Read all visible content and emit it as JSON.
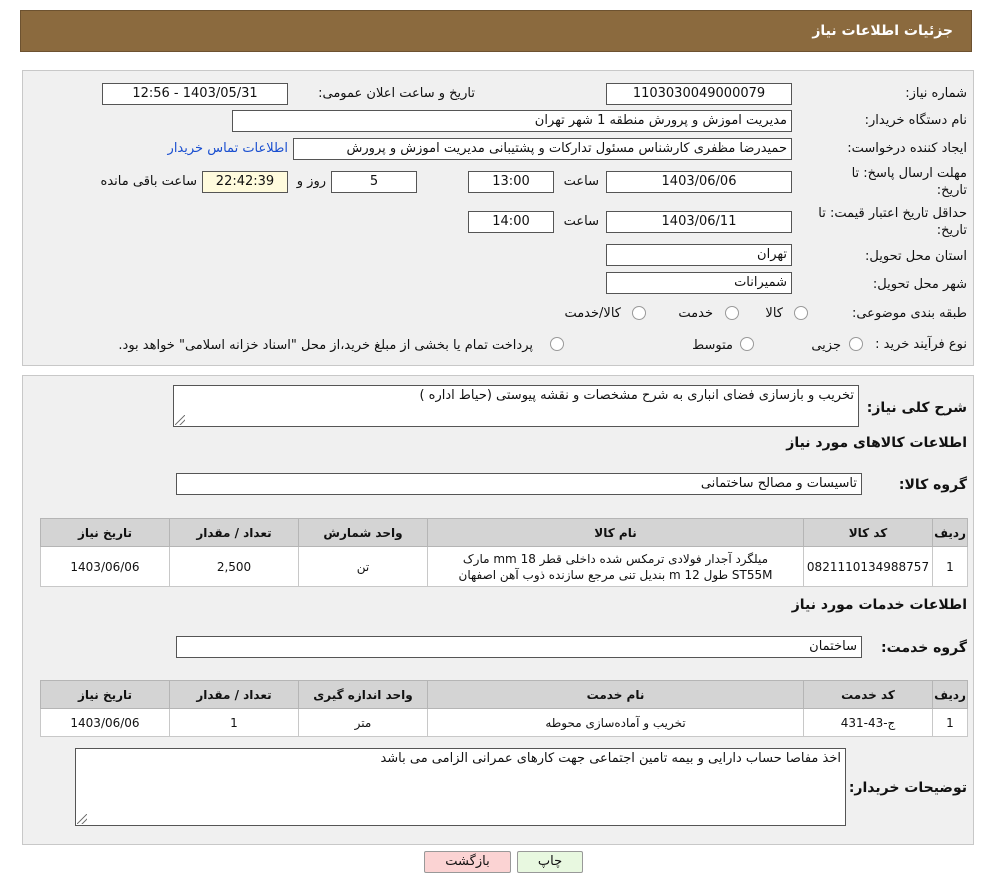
{
  "header": {
    "title": "جزئیات اطلاعات نیاز"
  },
  "top": {
    "need_number_label": "شماره نیاز:",
    "need_number": "1103030049000079",
    "announce_label": "تاریخ و ساعت اعلان عمومی:",
    "announce_value": "1403/05/31 - 12:56",
    "buyer_org_label": "نام دستگاه خریدار:",
    "buyer_org": "مدیریت اموزش و پرورش منطقه 1 شهر تهران",
    "creator_label": "ایجاد کننده درخواست:",
    "creator": "حمیدرضا مظفری کارشناس مسئول تدارکات و پشتیبانی مدیریت اموزش و پرورش",
    "contact_link": "اطلاعات تماس خریدار",
    "deadline_label_1": "مهلت ارسال پاسخ: تا",
    "deadline_label_2": "تاریخ:",
    "deadline_date": "1403/06/06",
    "time_label": "ساعت",
    "deadline_time": "13:00",
    "days_value": "5",
    "days_label": "روز و",
    "remaining_time": "22:42:39",
    "remaining_label": "ساعت باقی مانده",
    "validity_label_1": "حداقل تاریخ اعتبار قیمت: تا",
    "validity_label_2": "تاریخ:",
    "validity_date": "1403/06/11",
    "validity_time": "14:00",
    "province_label": "استان محل تحویل:",
    "province": "تهران",
    "city_label": "شهر محل تحویل:",
    "city": "شمیرانات",
    "category_label": "طبقه بندی موضوعی:",
    "category_options": [
      "کالا",
      "خدمت",
      "کالا/خدمت"
    ],
    "process_label": "نوع فرآیند خرید :",
    "process_options": [
      "جزیی",
      "متوسط"
    ],
    "process_note": "پرداخت تمام یا بخشی از مبلغ خرید،از محل \"اسناد خزانه اسلامی\" خواهد بود."
  },
  "main": {
    "summary_label": "شرح کلی نیاز:",
    "summary": "تخریب و بازسازی فضای انباری به شرح مشخصات و نقشه پیوستی  (حیاط اداره )",
    "goods_heading": "اطلاعات کالاهای مورد نیاز",
    "goods_group_label": "گروه کالا:",
    "goods_group": "تاسیسات و مصالح ساختمانی",
    "goods_table": {
      "headers": [
        "ردیف",
        "کد کالا",
        "نام کالا",
        "واحد شمارش",
        "تعداد / مقدار",
        "تاریخ نیاز"
      ],
      "rows": [
        {
          "row": "1",
          "code": "0821110134988757",
          "name_line1": "میلگرد آجدار فولادی ترمکس شده داخلی قطر 18 mm مارک",
          "name_line2": "ST55M طول 12 m بندیل تنی مرجع سازنده ذوب آهن اصفهان",
          "unit": "تن",
          "qty": "2,500",
          "date": "1403/06/06"
        }
      ]
    },
    "services_heading": "اطلاعات خدمات مورد نیاز",
    "service_group_label": "گروه خدمت:",
    "service_group": "ساختمان",
    "services_table": {
      "headers": [
        "ردیف",
        "کد خدمت",
        "نام خدمت",
        "واحد اندازه گیری",
        "تعداد / مقدار",
        "تاریخ نیاز"
      ],
      "rows": [
        {
          "row": "1",
          "code": "ج-43-431",
          "name": "تخریب و آماده‌سازی محوطه",
          "unit": "متر",
          "qty": "1",
          "date": "1403/06/06"
        }
      ]
    },
    "buyer_notes_label": "توضیحات خریدار:",
    "buyer_notes": "اخذ مفاصا حساب دارایی و بیمه تامین اجتماعی جهت کارهای عمرانی الزامی می باشد"
  },
  "buttons": {
    "print": "چاپ",
    "back": "بازگشت"
  },
  "colors": {
    "header_bg": "#8b6a3e",
    "link": "#1a4fd0",
    "back_button_bg": "#fbd3d3",
    "print_button_bg": "#e8f8e0"
  }
}
